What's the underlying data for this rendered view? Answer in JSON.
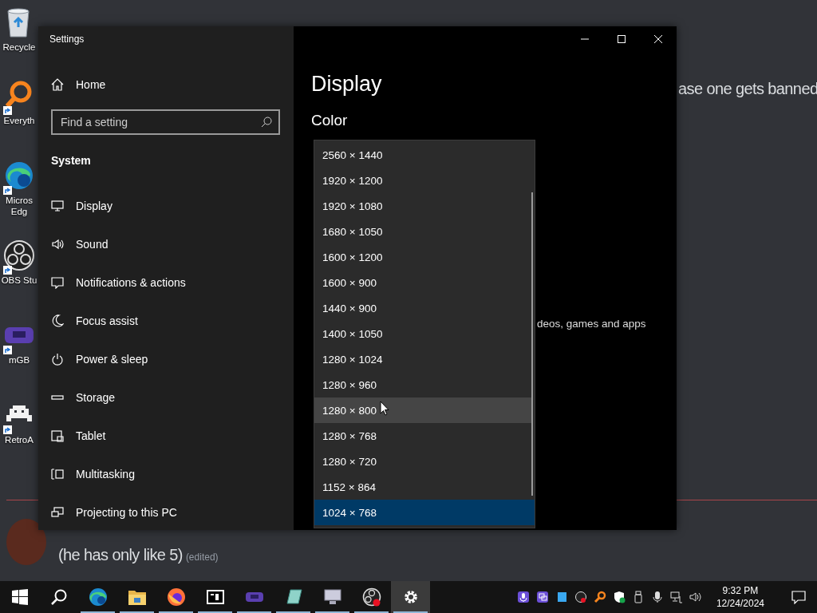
{
  "desktop": {
    "icons": [
      {
        "kind": "bin",
        "label": "Recycle"
      },
      {
        "kind": "magnifier",
        "label": "Everyth"
      },
      {
        "kind": "browser",
        "label": "Micros\nEdg"
      },
      {
        "kind": "recorder",
        "label": "OBS Stu"
      },
      {
        "kind": "console",
        "label": "mGB"
      },
      {
        "kind": "gamepad",
        "label": "RetroA"
      }
    ]
  },
  "chat": {
    "top_fragment": "ase one gets banned",
    "message": "(he has only like 5)",
    "edited": "(edited)"
  },
  "settings_window": {
    "title": "Settings",
    "sidebar": {
      "home": "Home",
      "search": {
        "placeholder": "Find a setting"
      },
      "section": "System",
      "items": [
        {
          "kind": "display",
          "label": "Display"
        },
        {
          "kind": "sound",
          "label": "Sound"
        },
        {
          "kind": "notifications",
          "label": "Notifications & actions"
        },
        {
          "kind": "focus",
          "label": "Focus assist"
        },
        {
          "kind": "power",
          "label": "Power & sleep"
        },
        {
          "kind": "storage",
          "label": "Storage"
        },
        {
          "kind": "tablet",
          "label": "Tablet"
        },
        {
          "kind": "multitasking",
          "label": "Multitasking"
        },
        {
          "kind": "projecting",
          "label": "Projecting to this PC"
        }
      ]
    },
    "content": {
      "heading": "Display",
      "subheading": "Color",
      "background_fragment": "deos, games and apps",
      "resolution_list": [
        {
          "label": "2560 × 1440",
          "selected": false,
          "hovered": false
        },
        {
          "label": "1920 × 1200",
          "selected": false,
          "hovered": false
        },
        {
          "label": "1920 × 1080",
          "selected": false,
          "hovered": false
        },
        {
          "label": "1680 × 1050",
          "selected": false,
          "hovered": false
        },
        {
          "label": "1600 × 1200",
          "selected": false,
          "hovered": false
        },
        {
          "label": "1600 × 900",
          "selected": false,
          "hovered": false
        },
        {
          "label": "1440 × 900",
          "selected": false,
          "hovered": false
        },
        {
          "label": "1400 × 1050",
          "selected": false,
          "hovered": false
        },
        {
          "label": "1280 × 1024",
          "selected": false,
          "hovered": false
        },
        {
          "label": "1280 × 960",
          "selected": false,
          "hovered": false
        },
        {
          "label": "1280 × 800",
          "selected": false,
          "hovered": true
        },
        {
          "label": "1280 × 768",
          "selected": false,
          "hovered": false
        },
        {
          "label": "1280 × 720",
          "selected": false,
          "hovered": false
        },
        {
          "label": "1152 × 864",
          "selected": false,
          "hovered": false
        },
        {
          "label": "1024 × 768",
          "selected": true,
          "hovered": false
        }
      ]
    }
  },
  "taskbar": {
    "apps": [
      {
        "kind": "start",
        "running": false,
        "active": false
      },
      {
        "kind": "search",
        "running": false,
        "active": false
      },
      {
        "kind": "browser",
        "running": true,
        "active": false
      },
      {
        "kind": "folder",
        "running": true,
        "active": false
      },
      {
        "kind": "firefox",
        "running": true,
        "active": false
      },
      {
        "kind": "archiver",
        "running": true,
        "active": false
      },
      {
        "kind": "console",
        "running": true,
        "active": false
      },
      {
        "kind": "notepad",
        "running": true,
        "active": false
      },
      {
        "kind": "computer",
        "running": true,
        "active": false
      },
      {
        "kind": "recorder",
        "running": true,
        "active": false
      },
      {
        "kind": "settings",
        "running": true,
        "active": true
      }
    ],
    "clock": {
      "time": "9:32 PM",
      "date": "12/24/2024"
    }
  }
}
